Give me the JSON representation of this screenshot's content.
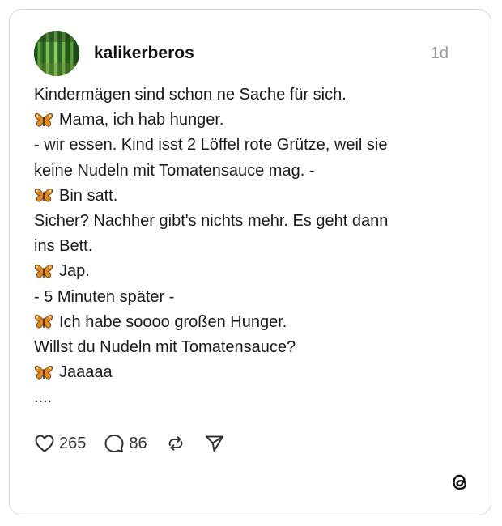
{
  "post": {
    "username": "kalikerberos",
    "time": "1d",
    "lines": [
      {
        "emoji": false,
        "text": "Kindermägen sind schon ne Sache für sich."
      },
      {
        "emoji": true,
        "text": "Mama, ich hab hunger."
      },
      {
        "emoji": false,
        "text": "- wir essen. Kind isst 2 Löffel rote Grütze, weil sie"
      },
      {
        "emoji": false,
        "text": "keine Nudeln mit Tomatensauce mag. -"
      },
      {
        "emoji": true,
        "text": "Bin satt."
      },
      {
        "emoji": false,
        "text": "Sicher? Nachher gibt's nichts mehr. Es geht dann"
      },
      {
        "emoji": false,
        "text": "ins Bett."
      },
      {
        "emoji": true,
        "text": "Jap."
      },
      {
        "emoji": false,
        "text": "- 5 Minuten später -"
      },
      {
        "emoji": true,
        "text": "Ich habe soooo großen Hunger."
      },
      {
        "emoji": false,
        "text": "Willst du Nudeln mit Tomatensauce?"
      },
      {
        "emoji": true,
        "text": "Jaaaaa"
      },
      {
        "emoji": false,
        "text": "...."
      }
    ],
    "emoji_icon": "butterfly-icon"
  },
  "actions": {
    "likes": "265",
    "replies": "86"
  },
  "icons": {
    "like": "heart-icon",
    "reply": "comment-icon",
    "repost": "repost-icon",
    "share": "send-icon",
    "brand": "threads-logo-icon"
  }
}
